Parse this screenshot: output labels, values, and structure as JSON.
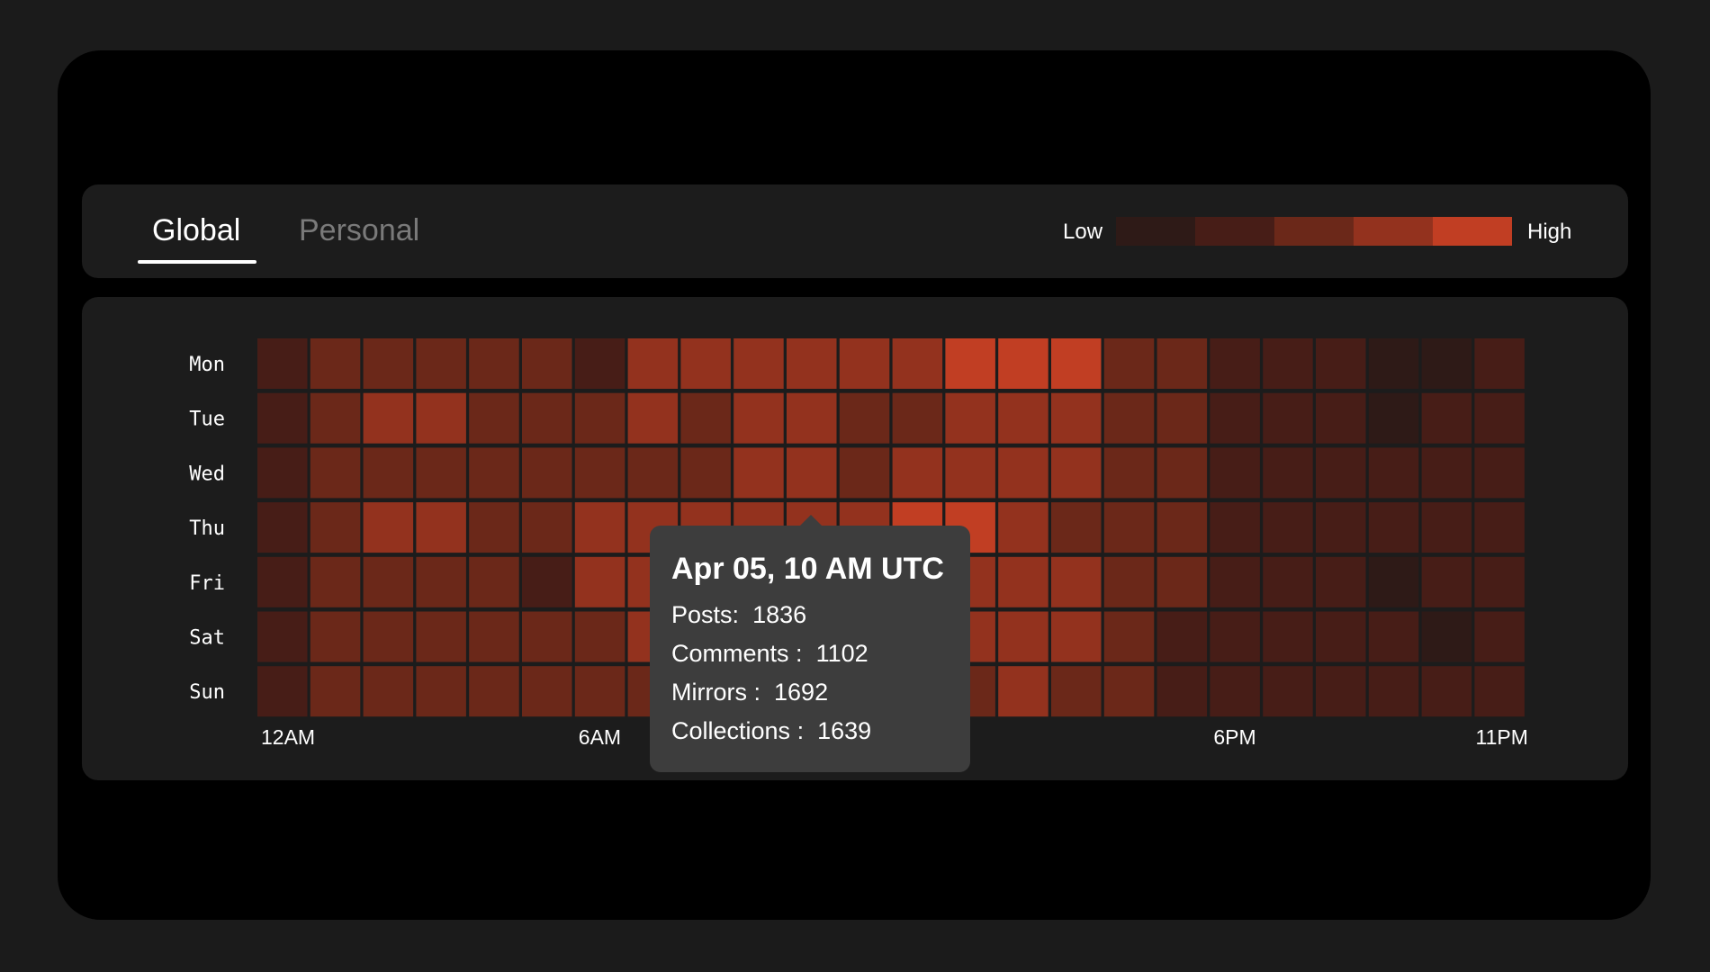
{
  "tabs": [
    {
      "label": "Global",
      "active": true
    },
    {
      "label": "Personal",
      "active": false
    }
  ],
  "legend": {
    "low_label": "Low",
    "high_label": "High",
    "colors": [
      "#2e1a17",
      "#471d17",
      "#6b2819",
      "#93321e",
      "#c13e23"
    ]
  },
  "tooltip": {
    "title": "Apr 05, 10 AM UTC",
    "rows": [
      {
        "label": "Posts",
        "sep": ":",
        "value": 1836
      },
      {
        "label": "Comments",
        "sep": " :",
        "value": 1102
      },
      {
        "label": "Mirrors",
        "sep": " :",
        "value": 1692
      },
      {
        "label": "Collections",
        "sep": " :",
        "value": 1639
      }
    ]
  },
  "chart_data": {
    "type": "heatmap",
    "rows": [
      "Mon",
      "Tue",
      "Wed",
      "Thu",
      "Fri",
      "Sat",
      "Sun"
    ],
    "columns": [
      "0",
      "1",
      "2",
      "3",
      "4",
      "5",
      "6",
      "7",
      "8",
      "9",
      "10",
      "11",
      "12",
      "13",
      "14",
      "15",
      "16",
      "17",
      "18",
      "19",
      "20",
      "21",
      "22",
      "23"
    ],
    "x_tick_labels": [
      {
        "index": 0,
        "label": "12AM"
      },
      {
        "index": 6,
        "label": "6AM"
      },
      {
        "index": 18,
        "label": "6PM"
      },
      {
        "index": 23,
        "label": "11PM"
      }
    ],
    "level_scale": {
      "min_label": "Low",
      "max_label": "High",
      "levels": 5
    },
    "levels": [
      [
        1,
        2,
        2,
        2,
        2,
        2,
        1,
        3,
        3,
        3,
        3,
        3,
        3,
        4,
        4,
        4,
        2,
        2,
        1,
        1,
        1,
        0,
        0,
        1
      ],
      [
        1,
        2,
        3,
        3,
        2,
        2,
        2,
        3,
        2,
        3,
        3,
        2,
        2,
        3,
        3,
        3,
        2,
        2,
        1,
        1,
        1,
        0,
        1,
        1
      ],
      [
        1,
        2,
        2,
        2,
        2,
        2,
        2,
        2,
        2,
        3,
        3,
        2,
        3,
        3,
        3,
        3,
        2,
        2,
        1,
        1,
        1,
        1,
        1,
        1
      ],
      [
        1,
        2,
        3,
        3,
        2,
        2,
        3,
        3,
        3,
        3,
        3,
        3,
        4,
        4,
        3,
        2,
        2,
        2,
        1,
        1,
        1,
        1,
        1,
        1
      ],
      [
        1,
        2,
        2,
        2,
        2,
        1,
        3,
        3,
        3,
        3,
        3,
        3,
        3,
        3,
        3,
        3,
        2,
        2,
        1,
        1,
        1,
        0,
        1,
        1
      ],
      [
        1,
        2,
        2,
        2,
        2,
        2,
        2,
        3,
        3,
        3,
        3,
        3,
        3,
        3,
        3,
        3,
        2,
        1,
        1,
        1,
        1,
        1,
        0,
        1
      ],
      [
        1,
        2,
        2,
        2,
        2,
        2,
        2,
        2,
        2,
        2,
        2,
        2,
        2,
        2,
        3,
        2,
        2,
        1,
        1,
        1,
        1,
        1,
        1,
        1
      ]
    ]
  }
}
